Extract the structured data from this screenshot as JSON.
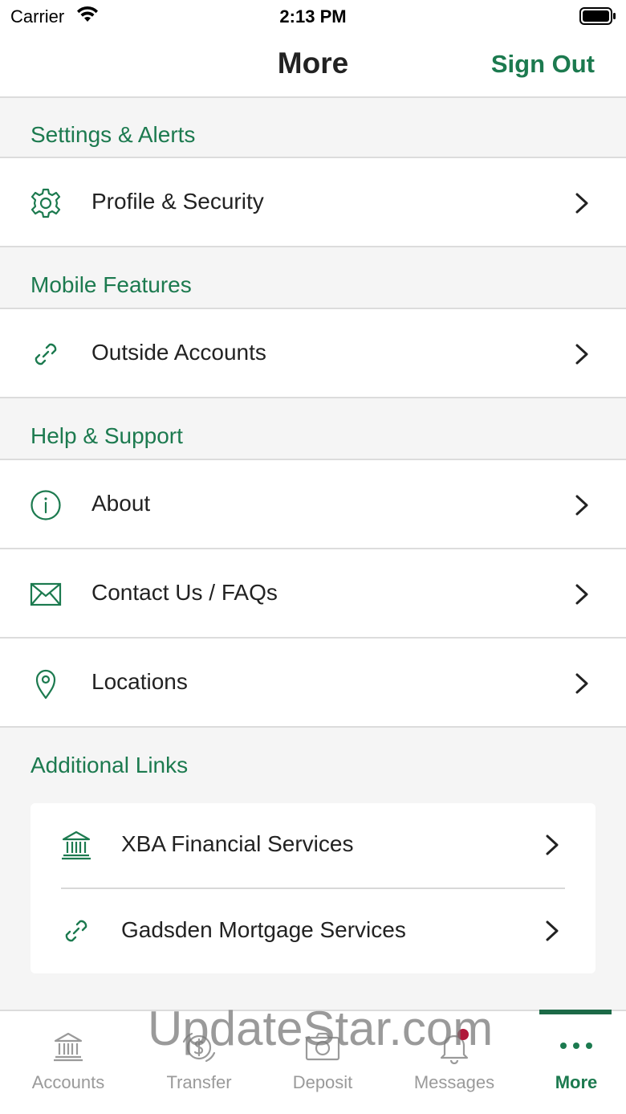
{
  "status_bar": {
    "carrier": "Carrier",
    "time": "2:13 PM"
  },
  "nav": {
    "title": "More",
    "sign_out": "Sign Out"
  },
  "sections": {
    "settings": {
      "header": "Settings & Alerts",
      "items": [
        {
          "label": "Profile & Security",
          "icon": "gear-icon"
        }
      ]
    },
    "mobile": {
      "header": "Mobile Features",
      "items": [
        {
          "label": "Outside Accounts",
          "icon": "link-icon"
        }
      ]
    },
    "help": {
      "header": "Help & Support",
      "items": [
        {
          "label": "About",
          "icon": "info-icon"
        },
        {
          "label": "Contact Us / FAQs",
          "icon": "mail-icon"
        },
        {
          "label": "Locations",
          "icon": "location-pin-icon"
        }
      ]
    },
    "additional": {
      "header": "Additional Links",
      "items": [
        {
          "label": "XBA Financial Services",
          "icon": "bank-icon"
        },
        {
          "label": "Gadsden Mortgage Services",
          "icon": "link-icon"
        }
      ]
    }
  },
  "tabs": [
    {
      "label": "Accounts",
      "icon": "bank-icon",
      "active": false
    },
    {
      "label": "Transfer",
      "icon": "transfer-dollar-icon",
      "active": false
    },
    {
      "label": "Deposit",
      "icon": "camera-icon",
      "active": false
    },
    {
      "label": "Messages",
      "icon": "bell-icon",
      "active": false,
      "badge": true
    },
    {
      "label": "More",
      "icon": "more-dots-icon",
      "active": true
    }
  ],
  "watermark": "UpdateStar.com",
  "colors": {
    "accent": "#1c7a4f",
    "badge": "#b0193a",
    "inactive": "#9a9a9a"
  }
}
